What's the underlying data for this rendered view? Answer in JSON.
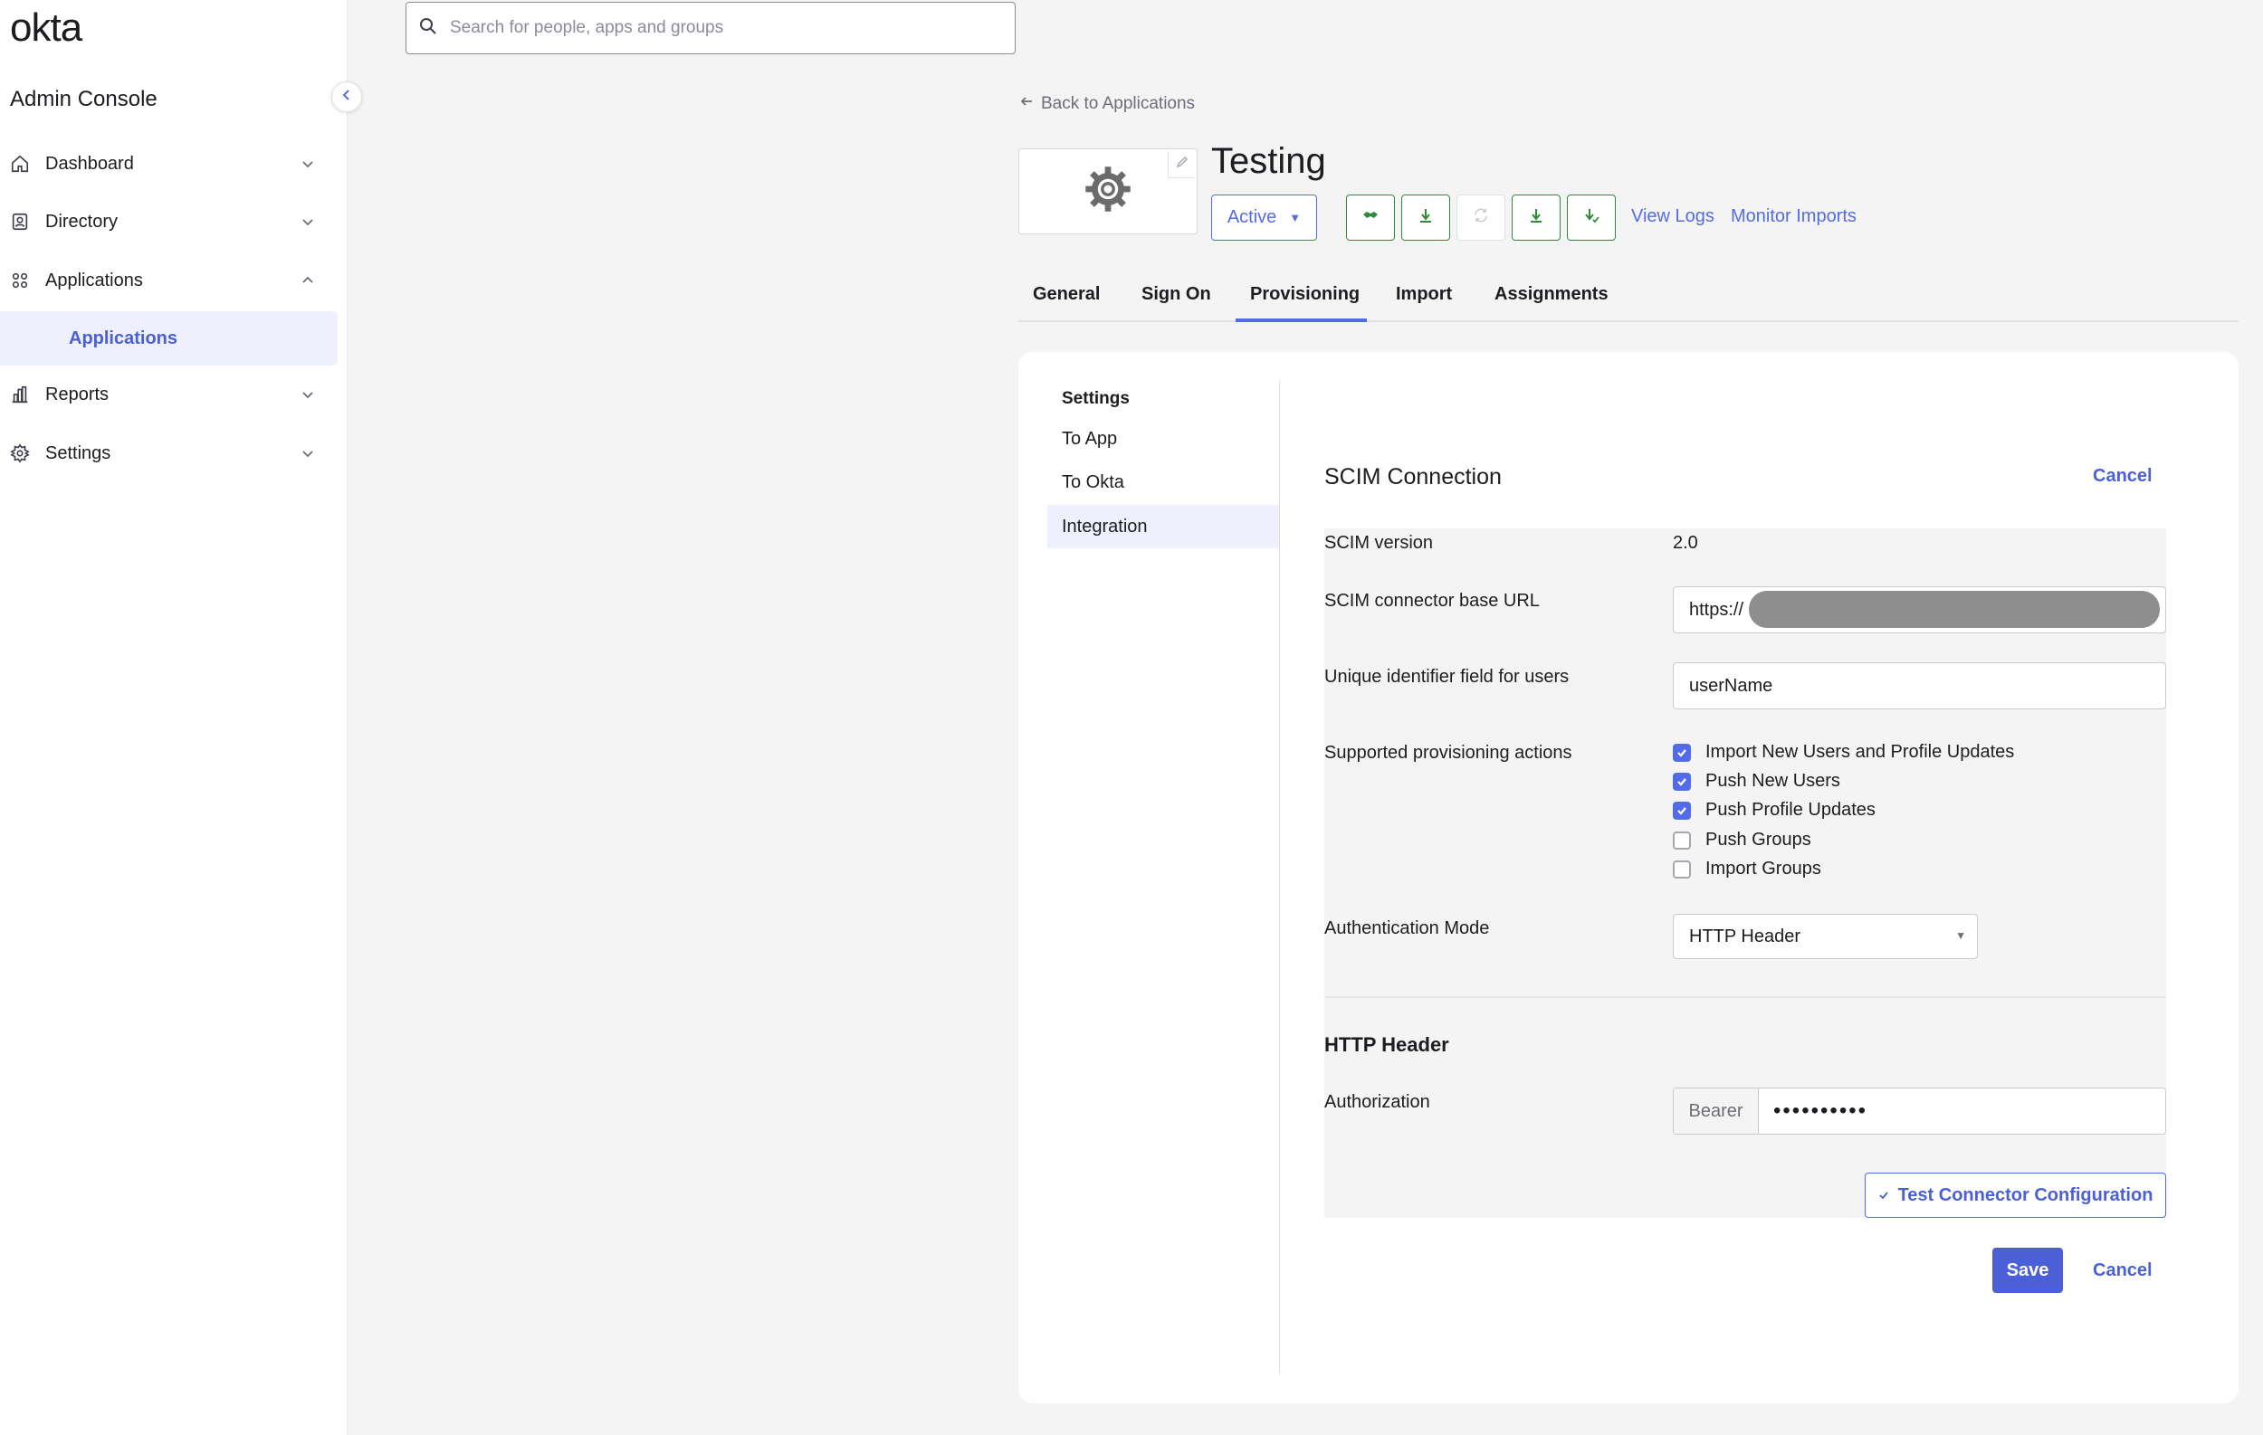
{
  "sidebar": {
    "logo": "okta",
    "console_title": "Admin Console",
    "items": [
      {
        "label": "Dashboard"
      },
      {
        "label": "Directory"
      },
      {
        "label": "Applications"
      },
      {
        "label": "Reports"
      },
      {
        "label": "Settings"
      }
    ],
    "sub_item": "Applications"
  },
  "search": {
    "placeholder": "Search for people, apps and groups"
  },
  "header": {
    "back_link": "Back to Applications",
    "app_title": "Testing",
    "status": "Active",
    "view_logs": "View Logs",
    "monitor_imports": "Monitor Imports"
  },
  "tabs": [
    {
      "label": "General"
    },
    {
      "label": "Sign On"
    },
    {
      "label": "Provisioning",
      "active": true
    },
    {
      "label": "Import"
    },
    {
      "label": "Assignments"
    }
  ],
  "side_menu": {
    "title": "Settings",
    "items": [
      {
        "label": "To App"
      },
      {
        "label": "To Okta"
      },
      {
        "label": "Integration",
        "active": true
      }
    ]
  },
  "scim": {
    "title": "SCIM Connection",
    "cancel_top": "Cancel",
    "version_label": "SCIM version",
    "version_value": "2.0",
    "base_url_label": "SCIM connector base URL",
    "base_url_value": "https://",
    "uid_label": "Unique identifier field for users",
    "uid_value": "userName",
    "actions_label": "Supported provisioning actions",
    "actions": [
      {
        "label": "Import New Users and Profile Updates",
        "checked": true
      },
      {
        "label": "Push New Users",
        "checked": true
      },
      {
        "label": "Push Profile Updates",
        "checked": true
      },
      {
        "label": "Push Groups",
        "checked": false
      },
      {
        "label": "Import Groups",
        "checked": false
      }
    ],
    "auth_mode_label": "Authentication Mode",
    "auth_mode_value": "HTTP Header",
    "http_header_title": "HTTP Header",
    "authorization_label": "Authorization",
    "authorization_prefix": "Bearer",
    "authorization_value": "••••••••••",
    "test_button": "Test Connector Configuration",
    "save_button": "Save",
    "cancel_bottom": "Cancel"
  },
  "colors": {
    "accent": "#546be7",
    "accent_dark": "#4b5fd6",
    "feature_green": "#2f8a3a",
    "page_bg": "#f4f4f4"
  }
}
